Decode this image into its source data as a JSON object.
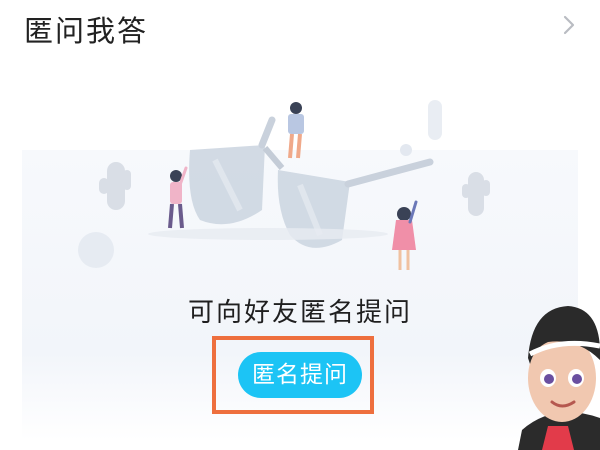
{
  "header": {
    "title": "匿问我答",
    "more_icon": "chevron-right-icon"
  },
  "main": {
    "illustration": "glasses-people-illustration",
    "prompt_text": "可向好友匿名提问",
    "ask_button_label": "匿名提问",
    "highlight_color": "#ee6f3e",
    "button_color": "#1cc4f5"
  },
  "overlay": {
    "avatar": "cartoon-avatar"
  }
}
